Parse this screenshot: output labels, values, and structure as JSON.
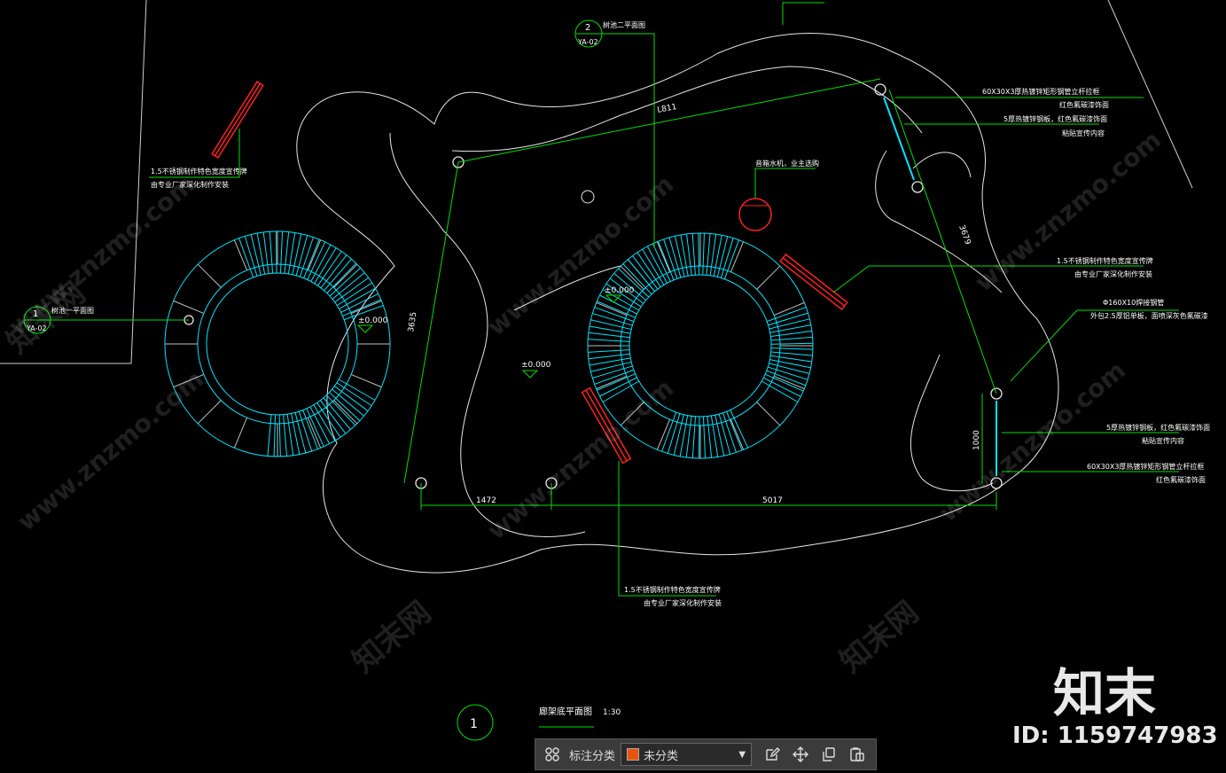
{
  "drawing": {
    "title": "廊架底平面图",
    "scale": "1:30",
    "title_index": "1",
    "callouts": [
      {
        "top": "1",
        "bottom": "YA-02",
        "label": "树池一平面图"
      },
      {
        "top": "2",
        "bottom": "YA-02",
        "label": "树池二平面图"
      }
    ],
    "notes": {
      "left_sign_1": "1.5不锈钢制作特色宽度宣传牌",
      "left_sign_2": "由专业厂家深化制作安装",
      "speaker": "音箱水机，业主选购",
      "top_right_1": "60X30X3厚热镀锌矩形钢管立杆拉框",
      "top_right_2": "红色氟碳漆饰面",
      "top_right_3": "5厚热镀锌钢板，红色氟碳漆饰面",
      "top_right_4": "粘贴宣传内容",
      "mid_right_1": "1.5不锈钢制作特色宽度宣传牌",
      "mid_right_2": "由专业厂家深化制作安装",
      "pipe_1": "Φ160X10焊接钢管",
      "pipe_2": "外包2.5厚铝单板，面喷深灰色氟碳漆",
      "bot_right_1": "5厚热镀锌钢板，红色氟碳漆饰面",
      "bot_right_2": "粘贴宣传内容",
      "bot_right_3": "60X30X3厚热镀锌矩形钢管立杆拉框",
      "bot_right_4": "红色氟碳漆饰面",
      "bottom_sign_1": "1.5不锈钢制作特色宽度宣传牌",
      "bottom_sign_2": "由专业厂家深化制作安装"
    },
    "dimensions": {
      "d_top": "L811",
      "d_left": "3635",
      "d_right": "3679",
      "d_vert": "1000",
      "d_bottom_left": "1472",
      "d_bottom_right": "5017"
    },
    "levels": {
      "level_left": "±0.000",
      "level_center": "±0.000",
      "level_ring": "±0.000"
    },
    "colors": {
      "outline": "#ffffff",
      "leader": "#00ff00",
      "ring": "#00ffff",
      "sign": "#ff0000"
    }
  },
  "watermark": {
    "site": "www.znzmo.com",
    "brand": "知末网",
    "logo": "知末",
    "id": "ID: 1159747983"
  },
  "toolbar": {
    "icon_grid": "grid-icon",
    "category_label": "标注分类",
    "category_value": "未分类",
    "category_color": "#e8540c",
    "icon_edit": "edit-icon",
    "icon_move": "move-icon",
    "icon_copy": "copy-icon",
    "icon_paste": "paste-icon"
  }
}
